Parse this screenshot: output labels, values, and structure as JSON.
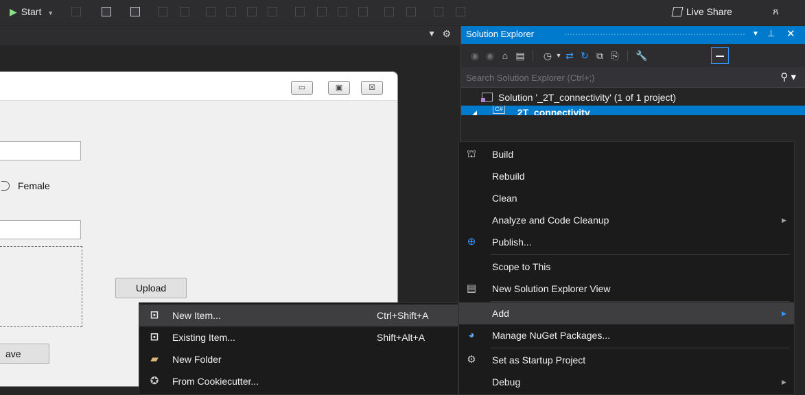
{
  "toolbar": {
    "start_label": "Start",
    "live_share_label": "Live Share"
  },
  "designer": {
    "radio_female_label": "Female",
    "upload_label": "Upload",
    "save_label": "ave",
    "minimize_glyph": "▭",
    "maximize_glyph": "▣",
    "close_glyph": "☒"
  },
  "solution_explorer": {
    "title": "Solution Explorer",
    "search_placeholder": "Search Solution Explorer (Ctrl+;)",
    "solution_row": "Solution '_2T_connectivity' (1 of 1 project)",
    "project_row": "_2T_connectivity",
    "project_icon_text": "C#"
  },
  "project_menu": {
    "items": [
      {
        "label": "Build",
        "icon": "build-icon"
      },
      {
        "label": "Rebuild"
      },
      {
        "label": "Clean"
      },
      {
        "label": "Analyze and Code Cleanup",
        "submenu": true
      },
      {
        "label": "Publish...",
        "icon": "publish-globe-icon"
      },
      {
        "label": "Scope to This"
      },
      {
        "label": "New Solution Explorer View",
        "icon": "new-view-icon"
      },
      {
        "label": "Add",
        "submenu": true,
        "highlighted": true
      },
      {
        "label": "Manage NuGet Packages...",
        "icon": "nuget-icon"
      },
      {
        "label": "Set as Startup Project",
        "icon": "gear-icon"
      },
      {
        "label": "Debug",
        "submenu": true
      }
    ]
  },
  "add_menu": {
    "items": [
      {
        "label": "New Item...",
        "shortcut": "Ctrl+Shift+A",
        "icon": "new-item-icon",
        "highlighted": true
      },
      {
        "label": "Existing Item...",
        "shortcut": "Shift+Alt+A",
        "icon": "existing-item-icon"
      },
      {
        "label": "New Folder",
        "icon": "new-folder-icon"
      },
      {
        "label": "From Cookiecutter...",
        "icon": "cookiecutter-icon"
      }
    ]
  },
  "colors": {
    "accent": "#007acc",
    "menu_bg": "#1b1b1c",
    "menu_highlight": "#3e3e40",
    "ide_bg": "#252526"
  }
}
